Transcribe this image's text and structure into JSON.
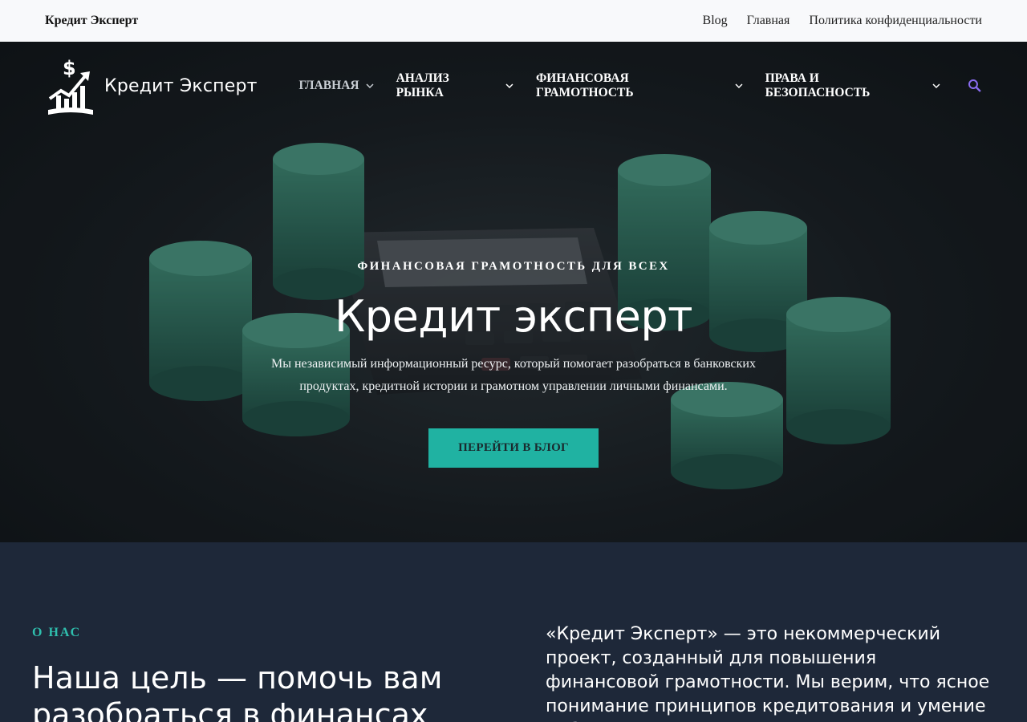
{
  "topbar": {
    "brand": "Кредит Эксперт",
    "links": [
      "Blog",
      "Главная",
      "Политика конфиденциальности"
    ]
  },
  "header": {
    "logo_text": "Кредит Эксперт",
    "menu": [
      {
        "label": "ГЛАВНАЯ",
        "active": true
      },
      {
        "label": "АНАЛИЗ РЫНКА",
        "active": false
      },
      {
        "label": "ФИНАНСОВАЯ ГРАМОТНОСТЬ",
        "active": false
      },
      {
        "label": "ПРАВА И БЕЗОПАСНОСТЬ",
        "active": false
      }
    ],
    "search_icon": "search-icon"
  },
  "hero": {
    "eyebrow": "ФИНАНСОВАЯ ГРАМОТНОСТЬ ДЛЯ ВСЕХ",
    "title": "Кредит эксперт",
    "text": "Мы независимый информационный ресурс, который помогает разобраться в банковских продуктах, кредитной истории и грамотном управлении личными финансами.",
    "cta": "ПЕРЕЙТИ В БЛОГ"
  },
  "about": {
    "kicker": "О НАС",
    "heading": "Наша цель — помочь вам разобраться в финансах",
    "paragraph": "«Кредит Эксперт» — это некоммерческий проект, созданный для повышения финансовой грамотности. Мы верим, что ясное понимание принципов кредитования и умение работать с"
  },
  "colors": {
    "accent": "#20b2a2",
    "kicker": "#2fbfae",
    "search": "#8a6cf0",
    "section_bg": "#1e2839",
    "topbar_bg": "#f8f9fb"
  }
}
